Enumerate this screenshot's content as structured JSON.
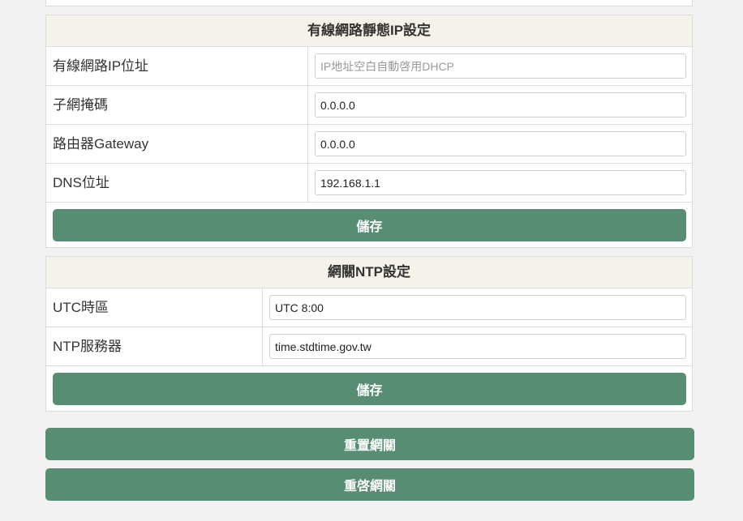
{
  "static_ip": {
    "title": "有線網路靜態IP設定",
    "fields": [
      {
        "label": "有線網路IP位址",
        "value": "",
        "placeholder": "IP地址空白自動啓用DHCP"
      },
      {
        "label": "子網掩碼",
        "value": "0.0.0.0",
        "placeholder": ""
      },
      {
        "label": "路由器Gateway",
        "value": "0.0.0.0",
        "placeholder": ""
      },
      {
        "label": "DNS位址",
        "value": "192.168.1.1",
        "placeholder": ""
      }
    ],
    "save_label": "儲存"
  },
  "ntp": {
    "title": "網關NTP設定",
    "fields": [
      {
        "label": "UTC時區",
        "value": "UTC 8:00"
      },
      {
        "label": "NTP服務器",
        "value": "time.stdtime.gov.tw"
      }
    ],
    "save_label": "儲存"
  },
  "actions": {
    "reset_label": "重置網關",
    "restart_label": "重啓網關"
  },
  "colors": {
    "accent": "#578d72",
    "header_bg": "#f5f2ea",
    "page_bg": "#f2f2f2"
  }
}
